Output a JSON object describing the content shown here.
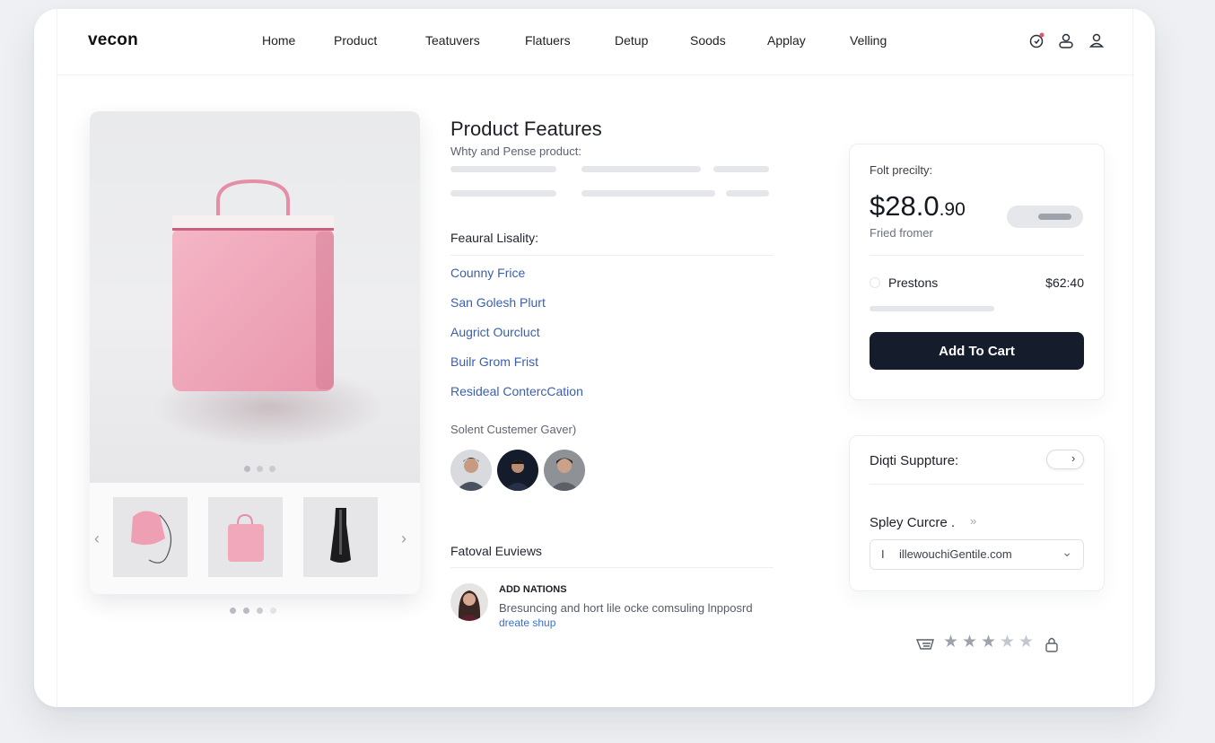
{
  "brand": "vecon",
  "nav": [
    "Home",
    "Product",
    "Teatuvers",
    "Flatuers",
    "Detup",
    "Soods",
    "Applay",
    "Velling"
  ],
  "header_icons": [
    "notification-icon",
    "user-icon",
    "account-icon"
  ],
  "product": {
    "title": "Product Features",
    "subtitle": "Whty and Pense product:",
    "image_alt": "pink-bag",
    "thumbnails": [
      "pink-lamp",
      "pink-bag",
      "black-bottle"
    ]
  },
  "features": {
    "label": "Feaural Lisality:",
    "items": [
      "Counny Frice",
      "San Golesh Plurt",
      "Augrict Ourcluct",
      "Builr Grom Frist",
      "Resideal ContercCation"
    ]
  },
  "customers": {
    "label": "Solent Custemer Gaver)"
  },
  "reviews": {
    "label": "Fatoval Euviews",
    "item": {
      "author": "ADD NATIONS",
      "text": "Bresuncing and hort lile ocke comsuling lnpposrd",
      "link": "dreate shup"
    }
  },
  "purchase": {
    "price_label": "Folt precilty:",
    "price_main": "$28.0",
    "price_cents": ".90",
    "price_sub": "Fried fromer",
    "option_label": "Prestons",
    "option_price": "$62:40",
    "cart_button": "Add To Cart"
  },
  "support": {
    "label": "Diqti Suppture:",
    "toggle_symbol": "›",
    "ship_label": "Spley Curcre .",
    "ship_symbol": "»",
    "email_prefix": "I",
    "email": "illewouchiGentile.com",
    "chevron": "⌄"
  },
  "rating": {
    "stars": 5,
    "filled": 3
  },
  "colors": {
    "accent": "#151c2c",
    "link": "#3a5fb0",
    "product": "#f0a7bb"
  }
}
